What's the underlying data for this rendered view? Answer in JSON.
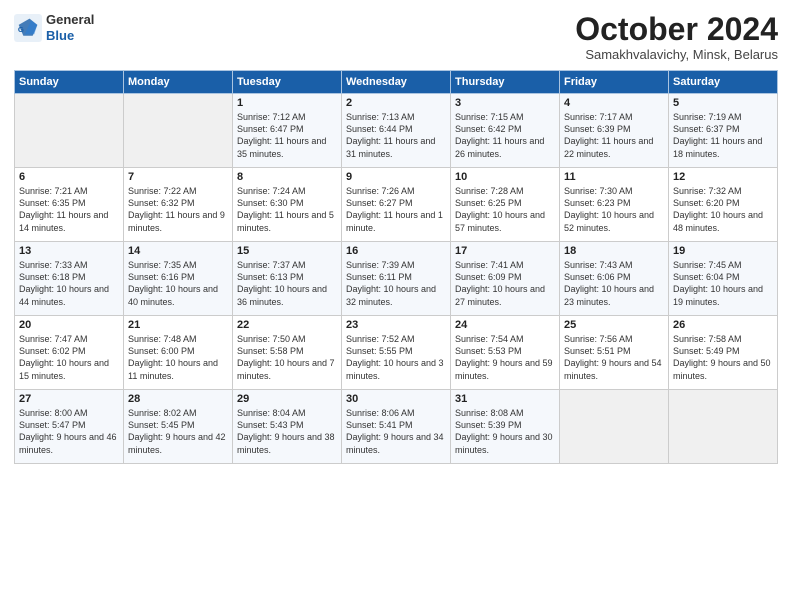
{
  "logo": {
    "line1": "General",
    "line2": "Blue"
  },
  "title": "October 2024",
  "location": "Samakhvalavichy, Minsk, Belarus",
  "days_of_week": [
    "Sunday",
    "Monday",
    "Tuesday",
    "Wednesday",
    "Thursday",
    "Friday",
    "Saturday"
  ],
  "weeks": [
    [
      {
        "day": "",
        "sunrise": "",
        "sunset": "",
        "daylight": ""
      },
      {
        "day": "",
        "sunrise": "",
        "sunset": "",
        "daylight": ""
      },
      {
        "day": "1",
        "sunrise": "Sunrise: 7:12 AM",
        "sunset": "Sunset: 6:47 PM",
        "daylight": "Daylight: 11 hours and 35 minutes."
      },
      {
        "day": "2",
        "sunrise": "Sunrise: 7:13 AM",
        "sunset": "Sunset: 6:44 PM",
        "daylight": "Daylight: 11 hours and 31 minutes."
      },
      {
        "day": "3",
        "sunrise": "Sunrise: 7:15 AM",
        "sunset": "Sunset: 6:42 PM",
        "daylight": "Daylight: 11 hours and 26 minutes."
      },
      {
        "day": "4",
        "sunrise": "Sunrise: 7:17 AM",
        "sunset": "Sunset: 6:39 PM",
        "daylight": "Daylight: 11 hours and 22 minutes."
      },
      {
        "day": "5",
        "sunrise": "Sunrise: 7:19 AM",
        "sunset": "Sunset: 6:37 PM",
        "daylight": "Daylight: 11 hours and 18 minutes."
      }
    ],
    [
      {
        "day": "6",
        "sunrise": "Sunrise: 7:21 AM",
        "sunset": "Sunset: 6:35 PM",
        "daylight": "Daylight: 11 hours and 14 minutes."
      },
      {
        "day": "7",
        "sunrise": "Sunrise: 7:22 AM",
        "sunset": "Sunset: 6:32 PM",
        "daylight": "Daylight: 11 hours and 9 minutes."
      },
      {
        "day": "8",
        "sunrise": "Sunrise: 7:24 AM",
        "sunset": "Sunset: 6:30 PM",
        "daylight": "Daylight: 11 hours and 5 minutes."
      },
      {
        "day": "9",
        "sunrise": "Sunrise: 7:26 AM",
        "sunset": "Sunset: 6:27 PM",
        "daylight": "Daylight: 11 hours and 1 minute."
      },
      {
        "day": "10",
        "sunrise": "Sunrise: 7:28 AM",
        "sunset": "Sunset: 6:25 PM",
        "daylight": "Daylight: 10 hours and 57 minutes."
      },
      {
        "day": "11",
        "sunrise": "Sunrise: 7:30 AM",
        "sunset": "Sunset: 6:23 PM",
        "daylight": "Daylight: 10 hours and 52 minutes."
      },
      {
        "day": "12",
        "sunrise": "Sunrise: 7:32 AM",
        "sunset": "Sunset: 6:20 PM",
        "daylight": "Daylight: 10 hours and 48 minutes."
      }
    ],
    [
      {
        "day": "13",
        "sunrise": "Sunrise: 7:33 AM",
        "sunset": "Sunset: 6:18 PM",
        "daylight": "Daylight: 10 hours and 44 minutes."
      },
      {
        "day": "14",
        "sunrise": "Sunrise: 7:35 AM",
        "sunset": "Sunset: 6:16 PM",
        "daylight": "Daylight: 10 hours and 40 minutes."
      },
      {
        "day": "15",
        "sunrise": "Sunrise: 7:37 AM",
        "sunset": "Sunset: 6:13 PM",
        "daylight": "Daylight: 10 hours and 36 minutes."
      },
      {
        "day": "16",
        "sunrise": "Sunrise: 7:39 AM",
        "sunset": "Sunset: 6:11 PM",
        "daylight": "Daylight: 10 hours and 32 minutes."
      },
      {
        "day": "17",
        "sunrise": "Sunrise: 7:41 AM",
        "sunset": "Sunset: 6:09 PM",
        "daylight": "Daylight: 10 hours and 27 minutes."
      },
      {
        "day": "18",
        "sunrise": "Sunrise: 7:43 AM",
        "sunset": "Sunset: 6:06 PM",
        "daylight": "Daylight: 10 hours and 23 minutes."
      },
      {
        "day": "19",
        "sunrise": "Sunrise: 7:45 AM",
        "sunset": "Sunset: 6:04 PM",
        "daylight": "Daylight: 10 hours and 19 minutes."
      }
    ],
    [
      {
        "day": "20",
        "sunrise": "Sunrise: 7:47 AM",
        "sunset": "Sunset: 6:02 PM",
        "daylight": "Daylight: 10 hours and 15 minutes."
      },
      {
        "day": "21",
        "sunrise": "Sunrise: 7:48 AM",
        "sunset": "Sunset: 6:00 PM",
        "daylight": "Daylight: 10 hours and 11 minutes."
      },
      {
        "day": "22",
        "sunrise": "Sunrise: 7:50 AM",
        "sunset": "Sunset: 5:58 PM",
        "daylight": "Daylight: 10 hours and 7 minutes."
      },
      {
        "day": "23",
        "sunrise": "Sunrise: 7:52 AM",
        "sunset": "Sunset: 5:55 PM",
        "daylight": "Daylight: 10 hours and 3 minutes."
      },
      {
        "day": "24",
        "sunrise": "Sunrise: 7:54 AM",
        "sunset": "Sunset: 5:53 PM",
        "daylight": "Daylight: 9 hours and 59 minutes."
      },
      {
        "day": "25",
        "sunrise": "Sunrise: 7:56 AM",
        "sunset": "Sunset: 5:51 PM",
        "daylight": "Daylight: 9 hours and 54 minutes."
      },
      {
        "day": "26",
        "sunrise": "Sunrise: 7:58 AM",
        "sunset": "Sunset: 5:49 PM",
        "daylight": "Daylight: 9 hours and 50 minutes."
      }
    ],
    [
      {
        "day": "27",
        "sunrise": "Sunrise: 8:00 AM",
        "sunset": "Sunset: 5:47 PM",
        "daylight": "Daylight: 9 hours and 46 minutes."
      },
      {
        "day": "28",
        "sunrise": "Sunrise: 8:02 AM",
        "sunset": "Sunset: 5:45 PM",
        "daylight": "Daylight: 9 hours and 42 minutes."
      },
      {
        "day": "29",
        "sunrise": "Sunrise: 8:04 AM",
        "sunset": "Sunset: 5:43 PM",
        "daylight": "Daylight: 9 hours and 38 minutes."
      },
      {
        "day": "30",
        "sunrise": "Sunrise: 8:06 AM",
        "sunset": "Sunset: 5:41 PM",
        "daylight": "Daylight: 9 hours and 34 minutes."
      },
      {
        "day": "31",
        "sunrise": "Sunrise: 8:08 AM",
        "sunset": "Sunset: 5:39 PM",
        "daylight": "Daylight: 9 hours and 30 minutes."
      },
      {
        "day": "",
        "sunrise": "",
        "sunset": "",
        "daylight": ""
      },
      {
        "day": "",
        "sunrise": "",
        "sunset": "",
        "daylight": ""
      }
    ]
  ]
}
